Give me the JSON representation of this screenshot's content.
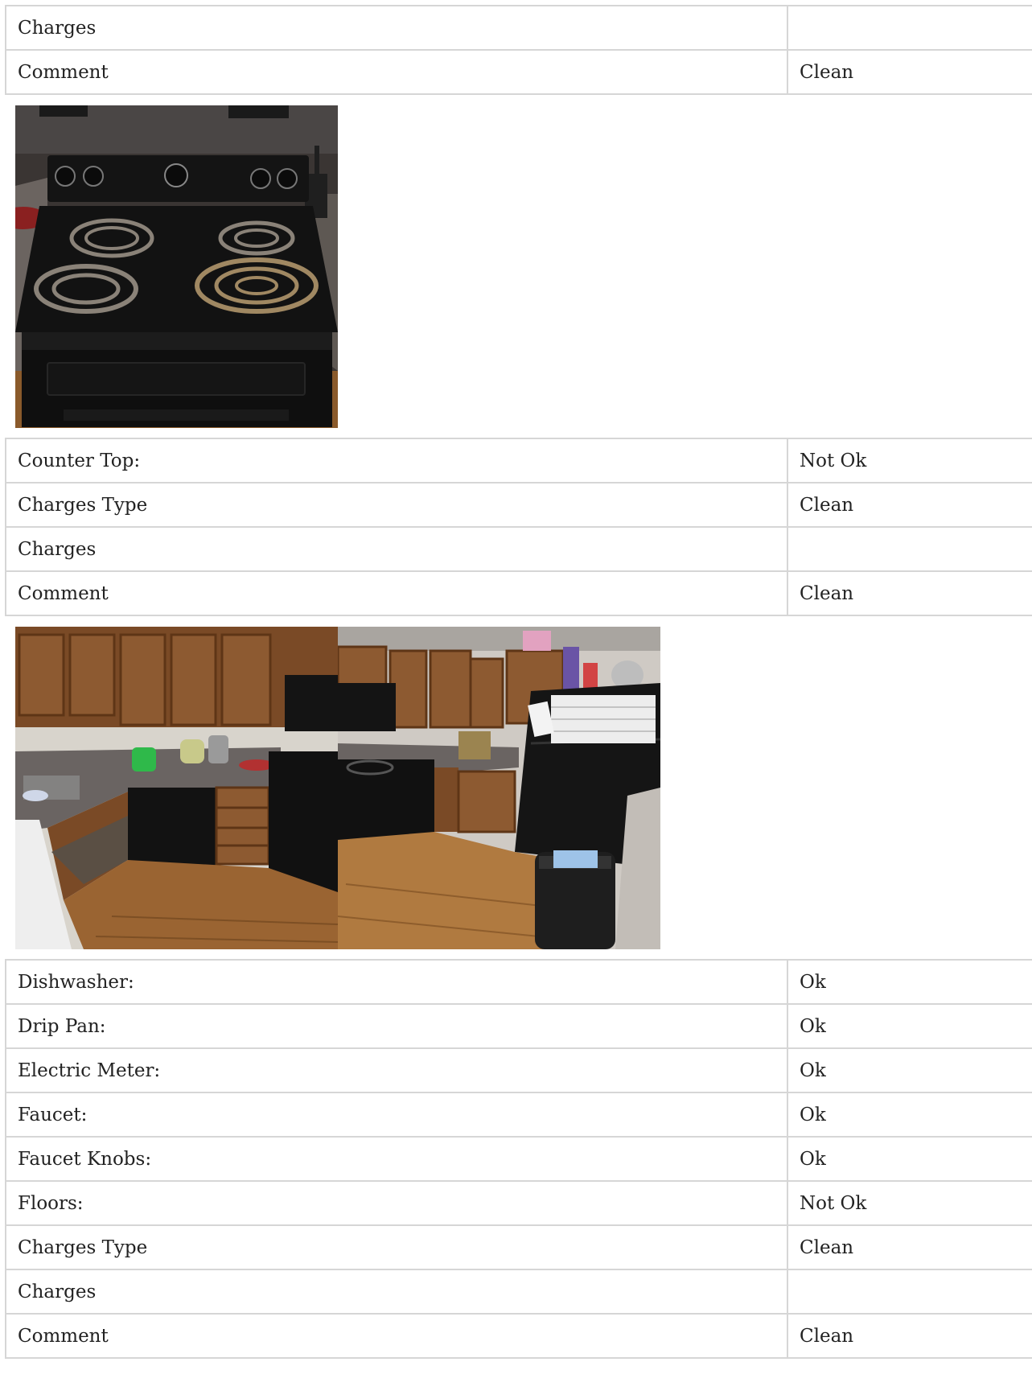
{
  "sections": [
    {
      "rows": [
        {
          "label": "Charges",
          "value": ""
        },
        {
          "label": "Comment",
          "value": "Clean"
        }
      ],
      "photos": [
        "stove-photo"
      ]
    },
    {
      "rows": [
        {
          "label": "Counter Top:",
          "value": "Not Ok"
        },
        {
          "label": "Charges Type",
          "value": "Clean"
        },
        {
          "label": "Charges",
          "value": ""
        },
        {
          "label": "Comment",
          "value": "Clean"
        }
      ],
      "photos": [
        "kitchen-photo-sink",
        "kitchen-photo-fridge"
      ]
    },
    {
      "rows": [
        {
          "label": "Dishwasher:",
          "value": "Ok"
        },
        {
          "label": "Drip Pan:",
          "value": "Ok"
        },
        {
          "label": "Electric Meter:",
          "value": "Ok"
        },
        {
          "label": "Faucet:",
          "value": "Ok"
        },
        {
          "label": "Faucet Knobs:",
          "value": "Ok"
        },
        {
          "label": "Floors:",
          "value": "Not Ok"
        },
        {
          "label": "Charges Type",
          "value": "Clean"
        },
        {
          "label": "Charges",
          "value": ""
        },
        {
          "label": "Comment",
          "value": "Clean"
        }
      ],
      "photos": []
    }
  ]
}
